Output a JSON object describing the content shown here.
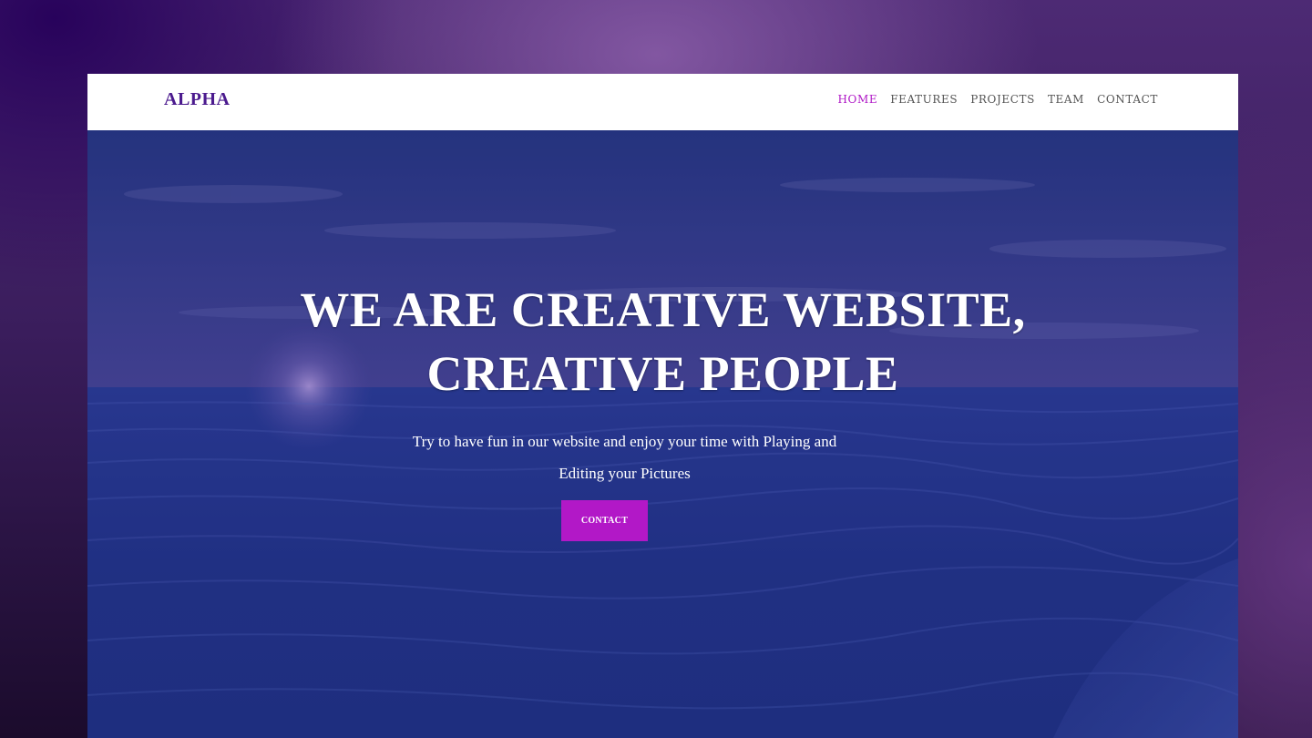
{
  "brand": "ALPHA",
  "nav": {
    "items": [
      "HOME",
      "FEATURES",
      "PROJECTS",
      "TEAM",
      "CONTACT"
    ],
    "active": "HOME"
  },
  "hero": {
    "headline": "WE ARE CREATIVE WEBSITE, CREATIVE PEOPLE",
    "subtitle": "Try to have fun in our website and enjoy your time with Playing and Editing your Pictures",
    "cta_label": "CONTACT",
    "background": "ocean-sunset-image"
  },
  "colors": {
    "accent": "#b218c7",
    "brand": "#4b1a8e",
    "hero_overlay": "#1f2d78",
    "nav_text": "#555555"
  }
}
